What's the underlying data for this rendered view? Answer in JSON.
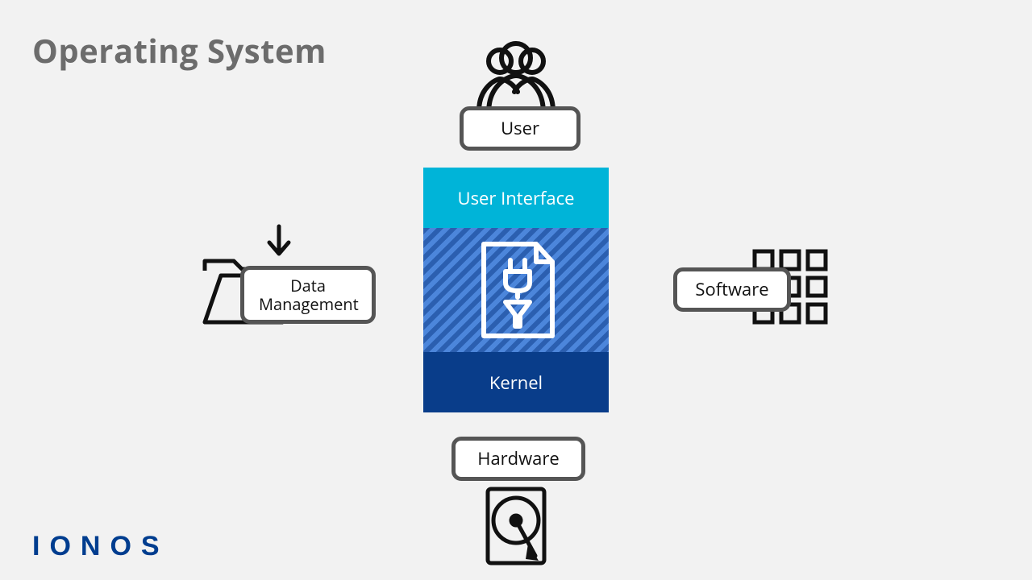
{
  "title": "Operating System",
  "brand": "IONOS",
  "labels": {
    "user": "User",
    "user_interface": "User Interface",
    "kernel": "Kernel",
    "hardware": "Hardware",
    "software": "Software",
    "data_management": "Data\nManagement"
  },
  "colors": {
    "bg": "#f2f2f2",
    "title": "#6c6c6c",
    "brand": "#003d8f",
    "ui_layer": "#00b4d8",
    "mid_layer_a": "#2b5fb0",
    "mid_layer_b": "#4c86db",
    "kernel_layer": "#093d8a",
    "pill_border": "#555555"
  }
}
